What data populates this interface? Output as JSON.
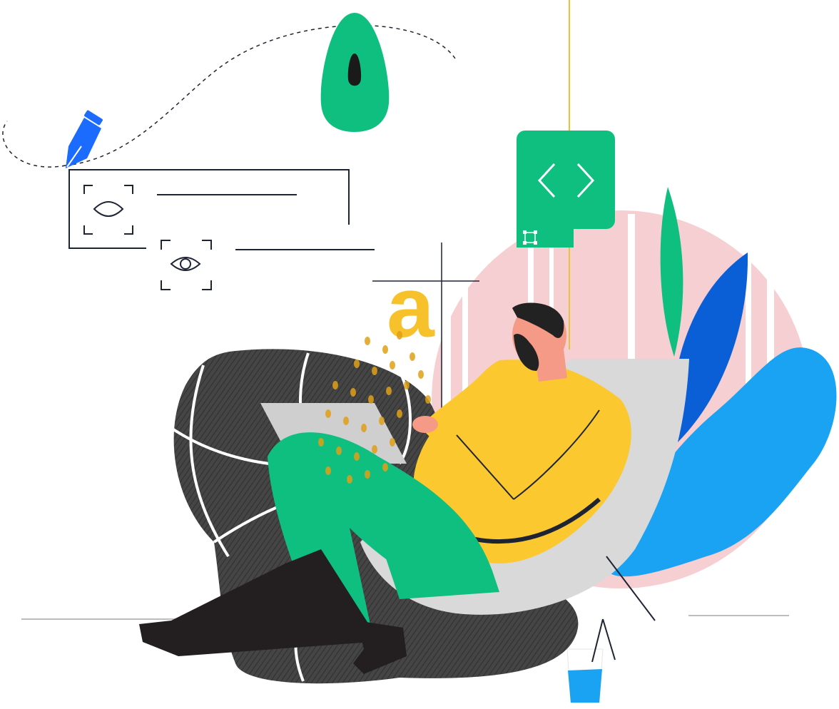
{
  "illustration": {
    "letter_glyph": "a",
    "icons": [
      "pen-tool-icon",
      "location-pin-icon",
      "code-brackets-icon",
      "eye-icon",
      "transform-handle-icon"
    ],
    "colors": {
      "green": "#0fbf7f",
      "yellow": "#fbc92f",
      "blue": "#1ba3f3",
      "deep_blue": "#0b5fd6",
      "pen_blue": "#1c6bff",
      "pink_circle": "#f6cfd2",
      "dark_gray": "#3e3e3e",
      "light_gray": "#d9d9d9",
      "skin": "#f59a86",
      "hair": "#222222",
      "boot": "#231f20",
      "outline": "#1f2433"
    }
  }
}
